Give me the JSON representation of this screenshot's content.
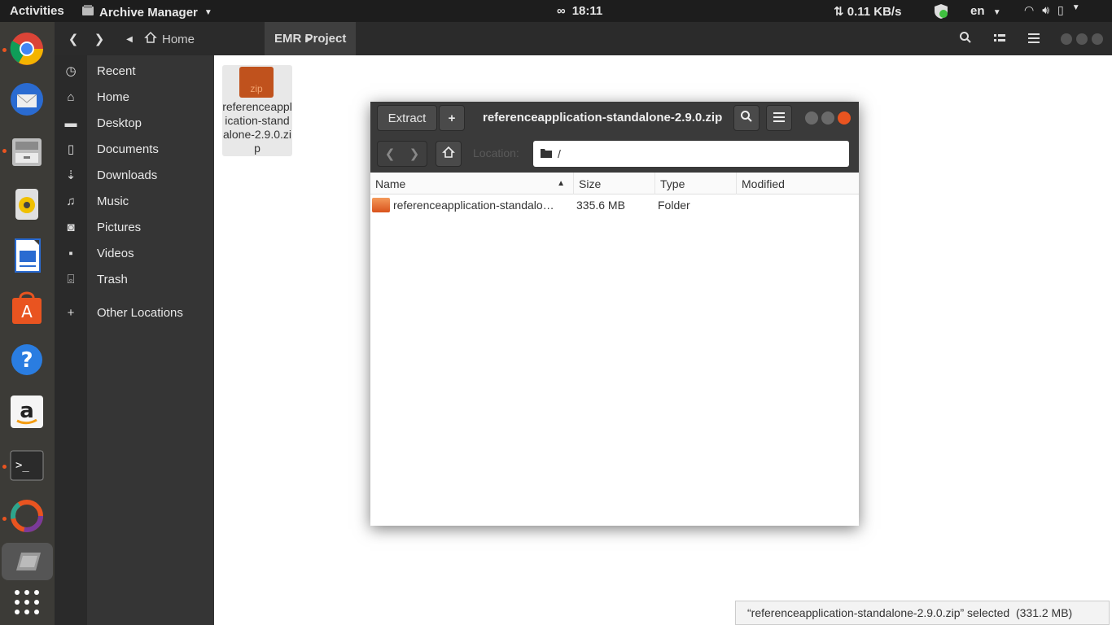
{
  "topbar": {
    "activities": "Activities",
    "app_name": "Archive Manager",
    "clock": "18:11",
    "net_speed": "⇅ 0.11 KB/s",
    "lang": "en"
  },
  "files": {
    "breadcrumb_home": "Home",
    "breadcrumb_current": "EMR Project",
    "sidebar": [
      {
        "label": "Recent",
        "icon": "clock-icon"
      },
      {
        "label": "Home",
        "icon": "home-icon"
      },
      {
        "label": "Desktop",
        "icon": "folder-icon"
      },
      {
        "label": "Documents",
        "icon": "document-icon"
      },
      {
        "label": "Downloads",
        "icon": "download-icon"
      },
      {
        "label": "Music",
        "icon": "music-icon"
      },
      {
        "label": "Pictures",
        "icon": "camera-icon"
      },
      {
        "label": "Videos",
        "icon": "video-icon"
      },
      {
        "label": "Trash",
        "icon": "trash-icon"
      },
      {
        "label": "Other Locations",
        "icon": "plus-icon"
      }
    ],
    "file_icon_text": "zip",
    "file_name": "referenceapplication-standalone-2.9.0.zip",
    "status": "“referenceapplication-standalone-2.9.0.zip” selected  (331.2 MB)"
  },
  "archive": {
    "extract_label": "Extract",
    "add_label": "+",
    "title": "referenceapplication-standalone-2.9.0.zip",
    "location_label": "Location:",
    "location_value": "/",
    "columns": {
      "name": "Name",
      "size": "Size",
      "type": "Type",
      "modified": "Modified"
    },
    "rows": [
      {
        "name": "referenceapplication-standalo…",
        "size": "335.6 MB",
        "type": "Folder",
        "modified": ""
      }
    ]
  },
  "colors": {
    "accent": "#e95420",
    "dock": "#3c3b37",
    "topbar": "#1d1d1d"
  }
}
